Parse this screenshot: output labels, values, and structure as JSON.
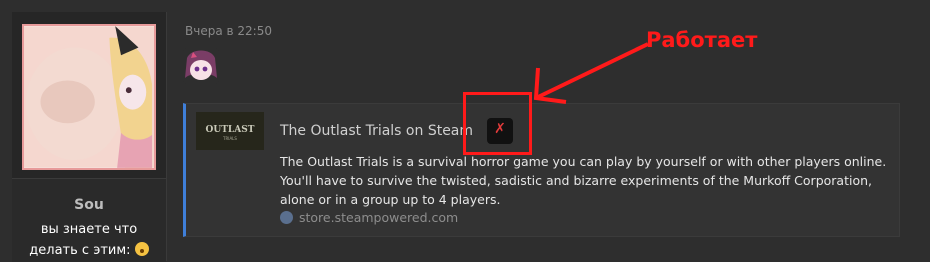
{
  "post": {
    "username": "Sou",
    "status_line1": "вы знаете что",
    "status_line2": "делать с этим:",
    "timestamp": "Вчера в 22:50"
  },
  "embed": {
    "thumbnail_text": "OUTLAST",
    "thumbnail_subtext": "TRIALS",
    "title": "The Outlast Trials on Steam",
    "badge_mark": "✗",
    "description": "The Outlast Trials is a survival horror game you can play by yourself or with other players online. You'll have to survive the twisted, sadistic and bizarre experiments of the Murkoff Corporation, alone or in a group up to 4 players.",
    "source": "store.steampowered.com"
  },
  "annotation": {
    "label": "Работает",
    "color": "#ff1a1a"
  },
  "colors": {
    "background": "#2e2e2e",
    "embed_accent": "#3f7fd9",
    "avatar_border": "#e79a9a"
  },
  "icons": [
    "avatar",
    "sticker",
    "emoji-icon",
    "steam-icon",
    "annotation-arrow-icon"
  ]
}
